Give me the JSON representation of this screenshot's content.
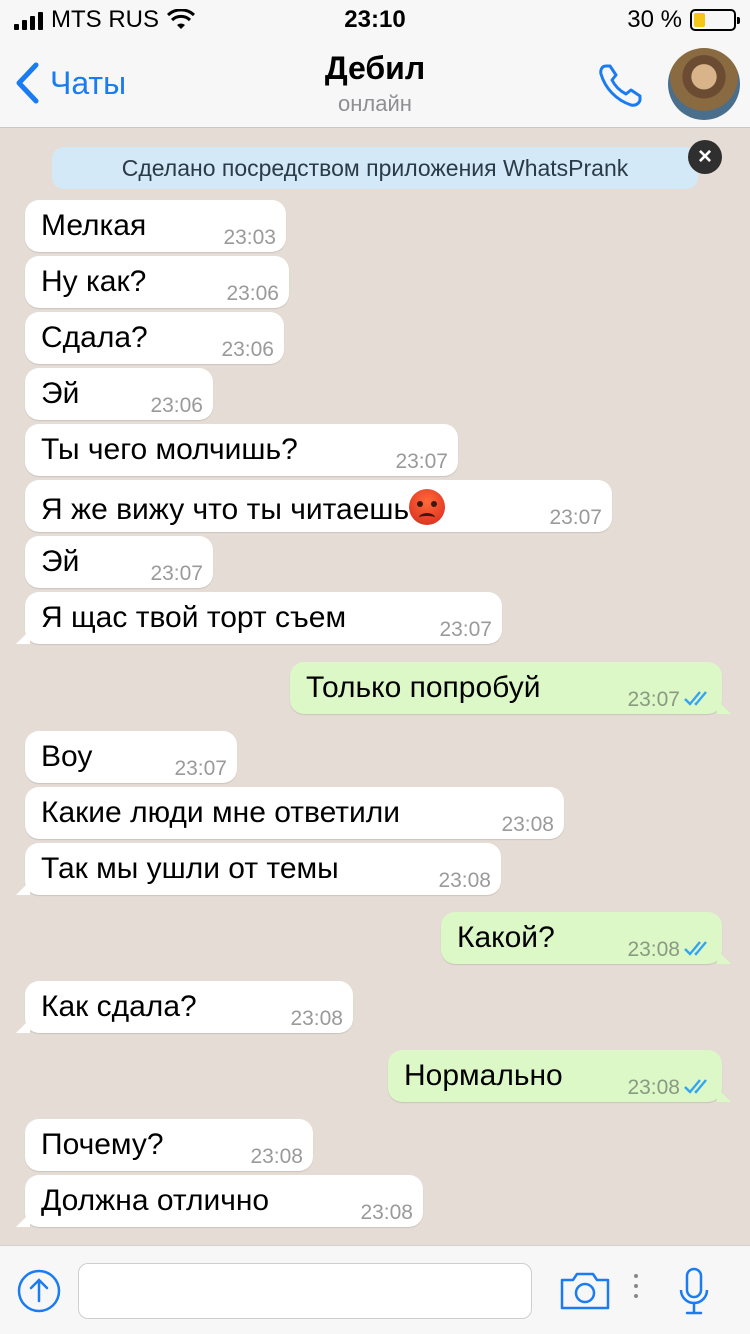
{
  "status_bar": {
    "carrier": "MTS RUS",
    "time": "23:10",
    "battery_percent": "30 %",
    "battery_level": 0.3,
    "battery_color": "#f5c518"
  },
  "header": {
    "back_label": "Чаты",
    "contact_name": "Дебил",
    "contact_status": "онлайн",
    "call_icon": "phone-icon",
    "accent_color": "#1a7cf0"
  },
  "banner": {
    "text": "Сделано посредством приложения WhatsPrank",
    "close_icon": "close-icon"
  },
  "messages": [
    {
      "dir": "in",
      "text": "Мелкая",
      "time": "23:03"
    },
    {
      "dir": "in",
      "text": "Ну как?",
      "time": "23:06"
    },
    {
      "dir": "in",
      "text": "Сдала?",
      "time": "23:06"
    },
    {
      "dir": "in",
      "text": "Эй",
      "time": "23:06"
    },
    {
      "dir": "in",
      "text": "Ты чего молчишь?",
      "time": "23:07"
    },
    {
      "dir": "in",
      "text": "Я же вижу что ты читаешь",
      "emoji": "angry-face",
      "time": "23:07"
    },
    {
      "dir": "in",
      "text": "Эй",
      "time": "23:07"
    },
    {
      "dir": "in",
      "text": "Я щас твой торт съем",
      "time": "23:07"
    },
    {
      "dir": "out",
      "text": "Только попробуй",
      "time": "23:07",
      "status": "read"
    },
    {
      "dir": "in",
      "text": "Воу",
      "time": "23:07"
    },
    {
      "dir": "in",
      "text": "Какие люди мне ответили",
      "time": "23:08"
    },
    {
      "dir": "in",
      "text": "Так мы ушли от темы",
      "time": "23:08"
    },
    {
      "dir": "out",
      "text": "Какой?",
      "time": "23:08",
      "status": "read"
    },
    {
      "dir": "in",
      "text": "Как сдала?",
      "time": "23:08"
    },
    {
      "dir": "out",
      "text": "Нормально",
      "time": "23:08",
      "status": "read"
    },
    {
      "dir": "in",
      "text": "Почему?",
      "time": "23:08"
    },
    {
      "dir": "in",
      "text": "Должна отлично",
      "time": "23:08"
    }
  ],
  "input_bar": {
    "message_value": "",
    "plus_icon": "arrow-up-circle-icon",
    "camera_icon": "camera-icon",
    "mic_icon": "microphone-icon"
  }
}
